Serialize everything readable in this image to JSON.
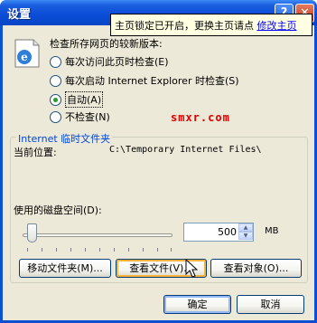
{
  "window": {
    "title": "设置",
    "help_label": "?",
    "close_label": "✕"
  },
  "tooltip": {
    "text": "主页锁定已开启，更换主页请点 ",
    "link": "修改主页"
  },
  "check_section": {
    "icon": "ie-page-icon",
    "label": "检查所存网页的较新版本:",
    "options": [
      {
        "label": "每次访问此页时检查(E)",
        "selected": false
      },
      {
        "label": "每次启动 Internet Explorer 时检查(S)",
        "selected": false
      },
      {
        "label": "自动(A)",
        "selected": true
      },
      {
        "label": "不检查(N)",
        "selected": false
      }
    ]
  },
  "watermark": "smxr.com",
  "temp_files": {
    "group_title": "Internet 临时文件夹",
    "current_location_label": "当前位置:",
    "current_location_value": "C:\\Temporary Internet Files\\",
    "disk_space_label": "使用的磁盘空间(D):",
    "disk_space_value": "500",
    "disk_space_unit": "MB",
    "slider_level_fraction": 0.02
  },
  "buttons": {
    "move_folder": "移动文件夹(M)...",
    "view_files": "查看文件(V)...",
    "view_objects": "查看对象(O)...",
    "ok": "确定",
    "cancel": "取消"
  }
}
